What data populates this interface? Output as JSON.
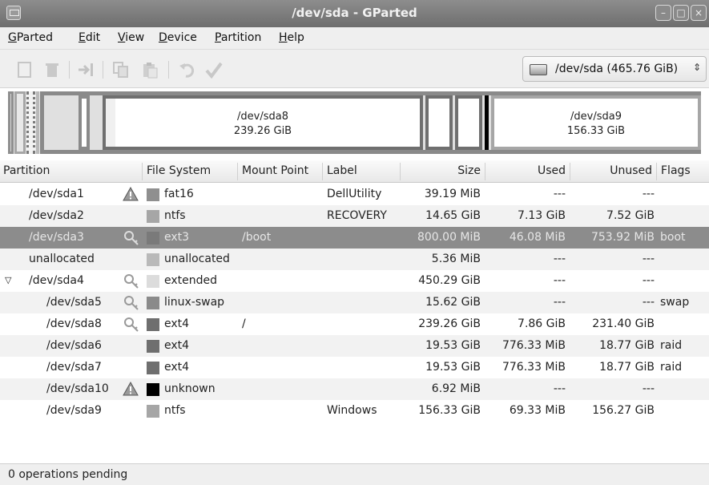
{
  "window": {
    "title": "/dev/sda - GParted"
  },
  "menu": [
    {
      "pre": "",
      "ul": "G",
      "post": "Parted"
    },
    {
      "pre": "",
      "ul": "E",
      "post": "dit"
    },
    {
      "pre": "",
      "ul": "V",
      "post": "iew"
    },
    {
      "pre": "",
      "ul": "D",
      "post": "evice"
    },
    {
      "pre": "",
      "ul": "P",
      "post": "artition"
    },
    {
      "pre": "",
      "ul": "H",
      "post": "elp"
    }
  ],
  "device": {
    "label": "/dev/sda  (465.76 GiB)"
  },
  "graph": {
    "sda8": {
      "name": "/dev/sda8",
      "size": "239.26 GiB"
    },
    "sda9": {
      "name": "/dev/sda9",
      "size": "156.33 GiB"
    }
  },
  "columns": [
    "Partition",
    "File System",
    "Mount Point",
    "Label",
    "Size",
    "Used",
    "Unused",
    "Flags"
  ],
  "rows": [
    {
      "partition": "/dev/sda1",
      "indent": 0,
      "icon": "warning",
      "fs": "fat16",
      "color": "#8f8f8f",
      "mount": "",
      "label": "DellUtility",
      "size": "39.19 MiB",
      "used": "---",
      "unused": "---",
      "flags": ""
    },
    {
      "partition": "/dev/sda2",
      "indent": 0,
      "icon": "",
      "fs": "ntfs",
      "color": "#a6a6a6",
      "mount": "",
      "label": "RECOVERY",
      "size": "14.65 GiB",
      "used": "7.13 GiB",
      "unused": "7.52 GiB",
      "flags": ""
    },
    {
      "partition": "/dev/sda3",
      "indent": 0,
      "icon": "key",
      "fs": "ext3",
      "color": "#7a7a7a",
      "mount": "/boot",
      "label": "",
      "size": "800.00 MiB",
      "used": "46.08 MiB",
      "unused": "753.92 MiB",
      "flags": "boot",
      "selected": true
    },
    {
      "partition": "unallocated",
      "indent": 0,
      "icon": "",
      "fs": "unallocated",
      "color": "#b9b9b9",
      "mount": "",
      "label": "",
      "size": "5.36 MiB",
      "used": "---",
      "unused": "---",
      "flags": ""
    },
    {
      "partition": "/dev/sda4",
      "indent": 0,
      "icon": "key",
      "fs": "extended",
      "color": "#dcdcdc",
      "mount": "",
      "label": "",
      "size": "450.29 GiB",
      "used": "---",
      "unused": "---",
      "flags": "",
      "expanded": true
    },
    {
      "partition": "/dev/sda5",
      "indent": 1,
      "icon": "key",
      "fs": "linux-swap",
      "color": "#8a8a8a",
      "mount": "",
      "label": "",
      "size": "15.62 GiB",
      "used": "---",
      "unused": "---",
      "flags": "swap"
    },
    {
      "partition": "/dev/sda8",
      "indent": 1,
      "icon": "key",
      "fs": "ext4",
      "color": "#6f6f6f",
      "mount": "/",
      "label": "",
      "size": "239.26 GiB",
      "used": "7.86 GiB",
      "unused": "231.40 GiB",
      "flags": ""
    },
    {
      "partition": "/dev/sda6",
      "indent": 1,
      "icon": "",
      "fs": "ext4",
      "color": "#6f6f6f",
      "mount": "",
      "label": "",
      "size": "19.53 GiB",
      "used": "776.33 MiB",
      "unused": "18.77 GiB",
      "flags": "raid"
    },
    {
      "partition": "/dev/sda7",
      "indent": 1,
      "icon": "",
      "fs": "ext4",
      "color": "#6f6f6f",
      "mount": "",
      "label": "",
      "size": "19.53 GiB",
      "used": "776.33 MiB",
      "unused": "18.77 GiB",
      "flags": "raid"
    },
    {
      "partition": "/dev/sda10",
      "indent": 1,
      "icon": "warning",
      "fs": "unknown",
      "color": "#000000",
      "mount": "",
      "label": "",
      "size": "6.92 MiB",
      "used": "---",
      "unused": "---",
      "flags": ""
    },
    {
      "partition": "/dev/sda9",
      "indent": 1,
      "icon": "",
      "fs": "ntfs",
      "color": "#a6a6a6",
      "mount": "",
      "label": "Windows",
      "size": "156.33 GiB",
      "used": "69.33 MiB",
      "unused": "156.27 GiB",
      "flags": ""
    }
  ],
  "status": "0 operations pending"
}
